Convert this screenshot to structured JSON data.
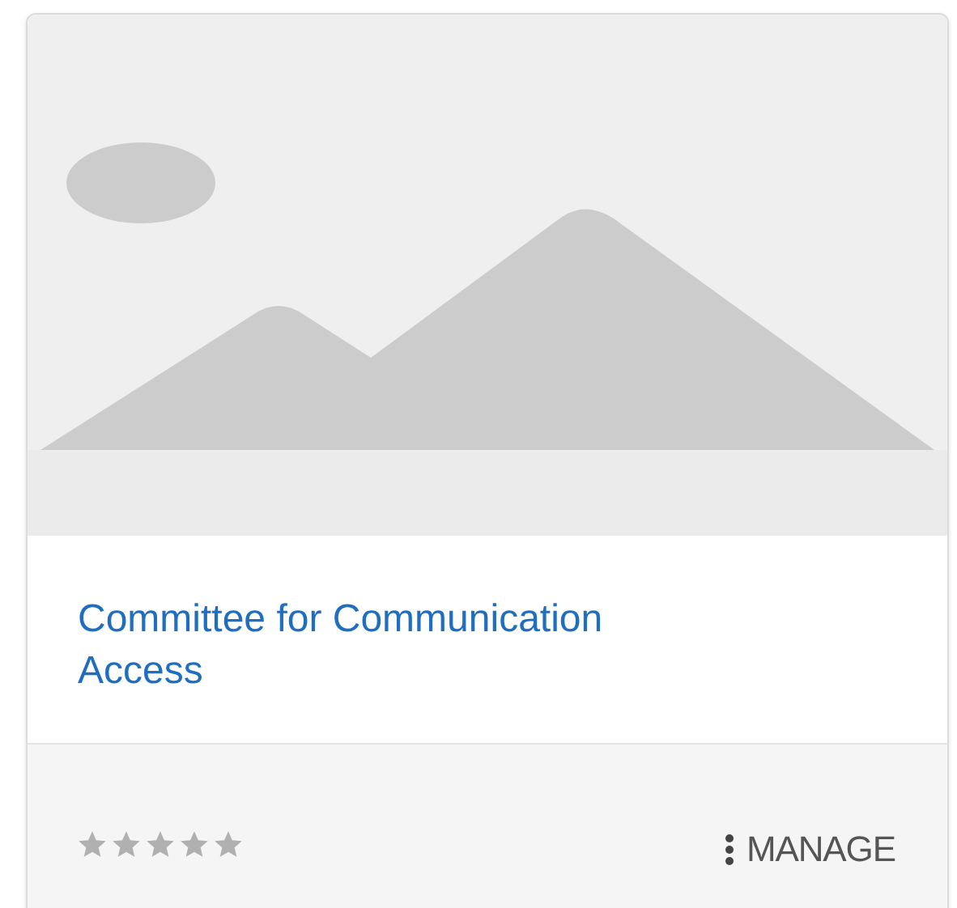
{
  "card": {
    "title": "Committee for Communication Access",
    "stars": 0,
    "manage_label": "MANAGE"
  }
}
